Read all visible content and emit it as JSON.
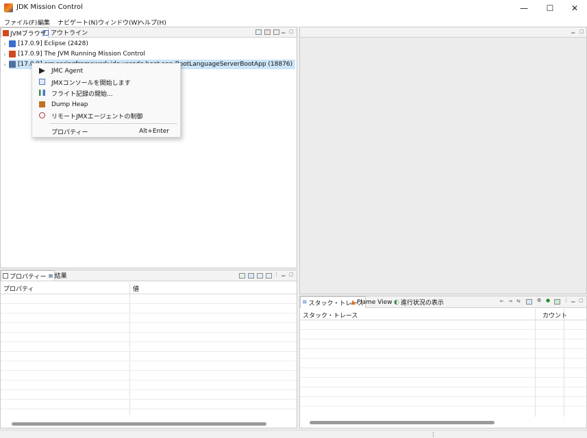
{
  "window": {
    "title": "JDK Mission Control",
    "minimize": "—",
    "maximize": "☐",
    "close": "✕"
  },
  "menubar": {
    "items": [
      "ファイル(F)",
      "編集",
      "ナビゲート(N)",
      "ウィンドウ(W)",
      "ヘルプ(H)"
    ]
  },
  "jvm_browser": {
    "tabs": [
      "JVMブラウザ",
      "アウトライン"
    ],
    "rows": [
      {
        "label": "[17.0.9] Eclipse (2428)",
        "icon": "eclipse-jvm-icon",
        "color": "#3a6fd0"
      },
      {
        "label": "[17.0.9] The JVM Running Mission Control",
        "icon": "jmc-jvm-icon",
        "color": "#d04a20"
      },
      {
        "label": "[17.0.9] org.springframework.ide.vscode.boot.app.BootLanguageServerBootApp (18876)",
        "icon": "java-jvm-icon",
        "color": "#5070a0"
      }
    ]
  },
  "context_menu": {
    "items": [
      {
        "label": "JMC Agent",
        "icon": "agent-icon",
        "color": "#222222"
      },
      {
        "label": "JMXコンソールを開始します",
        "icon": "console-icon",
        "color": "#4a7ac0"
      },
      {
        "label": "フライト記録の開始...",
        "icon": "flight-record-icon",
        "color": "#3a8a50"
      },
      {
        "label": "Dump Heap",
        "icon": "heap-dump-icon",
        "color": "#c07020"
      },
      {
        "label": "リモートJMXエージェントの制御",
        "icon": "remote-agent-icon",
        "color": "#b03030"
      }
    ],
    "properties": {
      "label": "プロパティー",
      "accelerator": "Alt+Enter"
    }
  },
  "properties_panel": {
    "tabs": [
      "プロパティー",
      "結果"
    ],
    "columns": [
      "プロパティ",
      "値"
    ]
  },
  "stack_panel": {
    "tabs": [
      "スタック・トレース",
      "Flame View",
      "進行状況の表示"
    ],
    "columns": [
      "スタック・トレース",
      "カウント"
    ]
  }
}
